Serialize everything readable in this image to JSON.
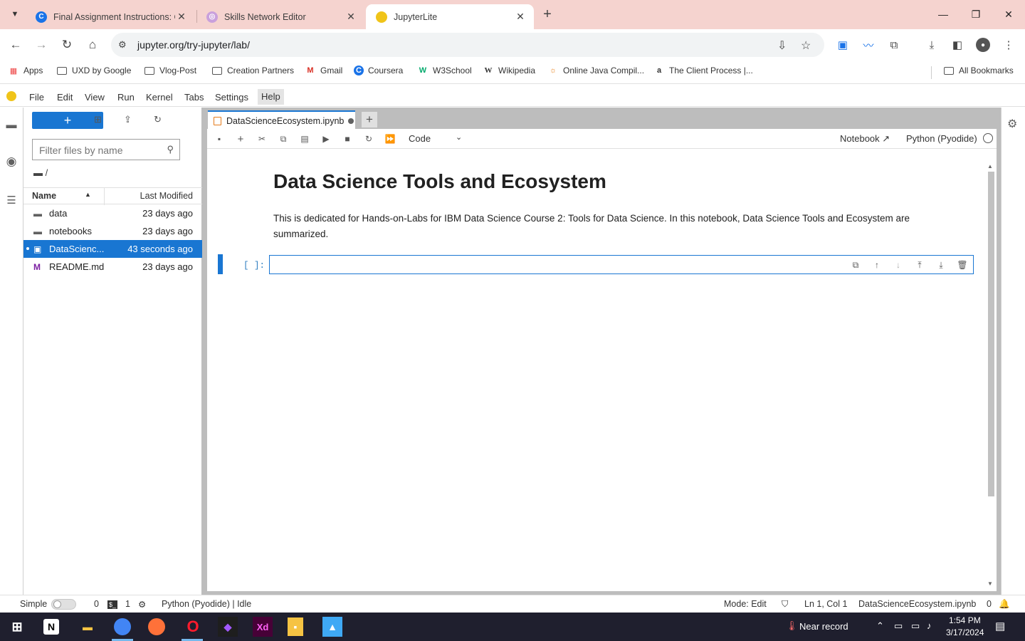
{
  "browser": {
    "tabs": [
      {
        "title": "Final Assignment Instructions: C",
        "favicon": "coursera-icon",
        "active": false
      },
      {
        "title": "Skills Network Editor",
        "favicon": "skills-network-icon",
        "active": false
      },
      {
        "title": "JupyterLite",
        "favicon": "jupyter-icon",
        "active": true
      }
    ],
    "url": "jupyter.org/try-jupyter/lab/",
    "bookmarks": [
      {
        "label": "Apps"
      },
      {
        "label": "UXD by Google"
      },
      {
        "label": "Vlog-Post"
      },
      {
        "label": "Creation Partners"
      },
      {
        "label": "Gmail"
      },
      {
        "label": "Coursera"
      },
      {
        "label": "W3School"
      },
      {
        "label": "Wikipedia"
      },
      {
        "label": "Online Java Compil..."
      },
      {
        "label": "The Client Process |..."
      }
    ],
    "all_bookmarks": "All Bookmarks"
  },
  "menubar": {
    "items": [
      "File",
      "Edit",
      "View",
      "Run",
      "Kernel",
      "Tabs",
      "Settings",
      "Help"
    ]
  },
  "filebrowser": {
    "new_label": "+",
    "filter_placeholder": "Filter files by name",
    "crumb": "/",
    "col_name": "Name",
    "col_modified": "Last Modified",
    "files": [
      {
        "name": "data",
        "modified": "23 days ago",
        "type": "folder"
      },
      {
        "name": "notebooks",
        "modified": "23 days ago",
        "type": "folder"
      },
      {
        "name": "DataScienc...",
        "modified": "43 seconds ago",
        "type": "notebook",
        "selected": true
      },
      {
        "name": "README.md",
        "modified": "23 days ago",
        "type": "markdown"
      }
    ]
  },
  "notebook": {
    "tab_title": "DataScienceEcosystem.ipynb",
    "cell_type": "Code",
    "notebook_label": "Notebook",
    "kernel": "Python (Pyodide)",
    "heading": "Data Science Tools and Ecosystem",
    "paragraph": "This is dedicated for Hands-on-Labs for IBM Data Science Course 2: Tools for Data Science. In this notebook, Data Science Tools and Ecosystem are summarized.",
    "prompt": "[ ]:"
  },
  "statusbar": {
    "simple": "Simple",
    "count_a": "0",
    "count_b": "1",
    "kernel_status": "Python (Pyodide) | Idle",
    "mode": "Mode: Edit",
    "position": "Ln 1, Col 1",
    "filename": "DataScienceEcosystem.ipynb",
    "count_c": "0"
  },
  "taskbar": {
    "weather": "Near record",
    "time": "1:54 PM",
    "date": "3/17/2024"
  }
}
